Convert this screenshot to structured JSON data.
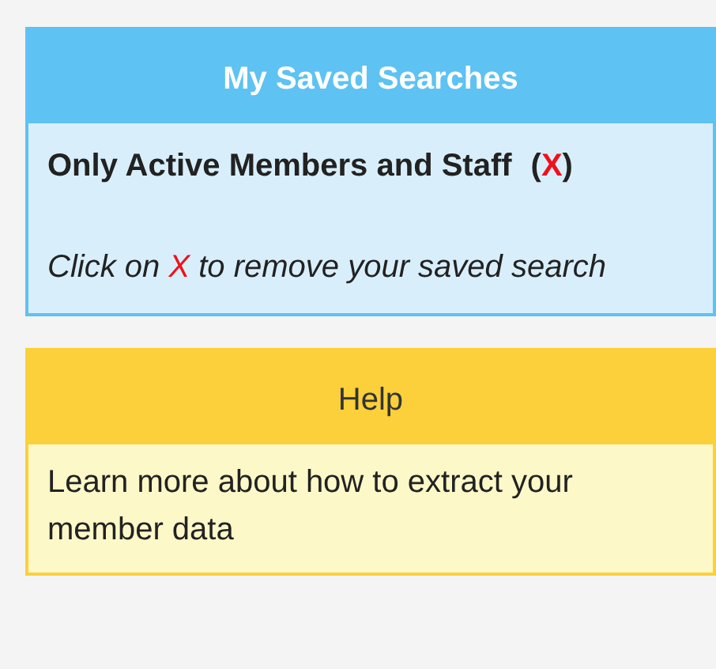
{
  "saved_searches": {
    "title": "My Saved Searches",
    "items": [
      {
        "name": "Only Active Members and Staff",
        "remove_open": "(",
        "remove_label": "X",
        "remove_close": ")"
      }
    ],
    "hint": {
      "before": "Click on ",
      "mark": "X",
      "after": " to remove your saved search"
    }
  },
  "help": {
    "title": "Help",
    "text": "Learn more about how to extract your member data"
  }
}
